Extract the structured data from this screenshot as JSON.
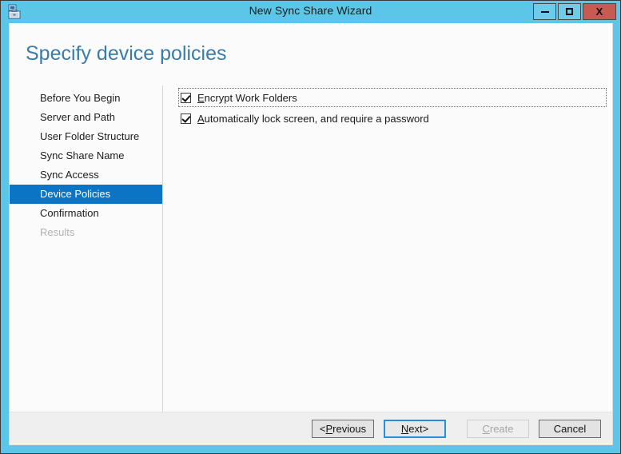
{
  "window": {
    "title": "New Sync Share Wizard",
    "icon": "wizard-server-icon",
    "controls": {
      "minimize": "minimize-icon",
      "maximize": "maximize-icon",
      "close": "X"
    },
    "colors": {
      "titlebar": "#5bc6e8",
      "close_button": "#c75b52",
      "accent_selected": "#0b74c4",
      "heading": "#3a7ca8"
    }
  },
  "page": {
    "heading": "Specify device policies"
  },
  "nav": {
    "items": [
      {
        "label": "Before You Begin",
        "state": "normal"
      },
      {
        "label": "Server and Path",
        "state": "normal"
      },
      {
        "label": "User Folder Structure",
        "state": "normal"
      },
      {
        "label": "Sync Share Name",
        "state": "normal"
      },
      {
        "label": "Sync Access",
        "state": "normal"
      },
      {
        "label": "Device Policies",
        "state": "selected"
      },
      {
        "label": "Confirmation",
        "state": "normal"
      },
      {
        "label": "Results",
        "state": "disabled"
      }
    ]
  },
  "content": {
    "options": [
      {
        "label": "Encrypt Work Folders",
        "accesskey": "E",
        "label_rest": "ncrypt Work Folders",
        "checked": true,
        "focused": true
      },
      {
        "label": "Automatically lock screen, and require a password",
        "accesskey": "A",
        "label_rest": "utomatically lock screen, and require a password",
        "checked": true,
        "focused": false
      }
    ]
  },
  "footer": {
    "buttons": [
      {
        "prefix": "< ",
        "accesskey": "P",
        "rest": "revious",
        "suffix": "",
        "state": "normal"
      },
      {
        "prefix": "",
        "accesskey": "N",
        "rest": "ext",
        "suffix": " >",
        "state": "default"
      },
      {
        "prefix": "",
        "accesskey": "C",
        "rest": "reate",
        "suffix": "",
        "state": "disabled"
      },
      {
        "prefix": "",
        "accesskey": "",
        "rest": "Cancel",
        "suffix": "",
        "state": "normal"
      }
    ]
  }
}
